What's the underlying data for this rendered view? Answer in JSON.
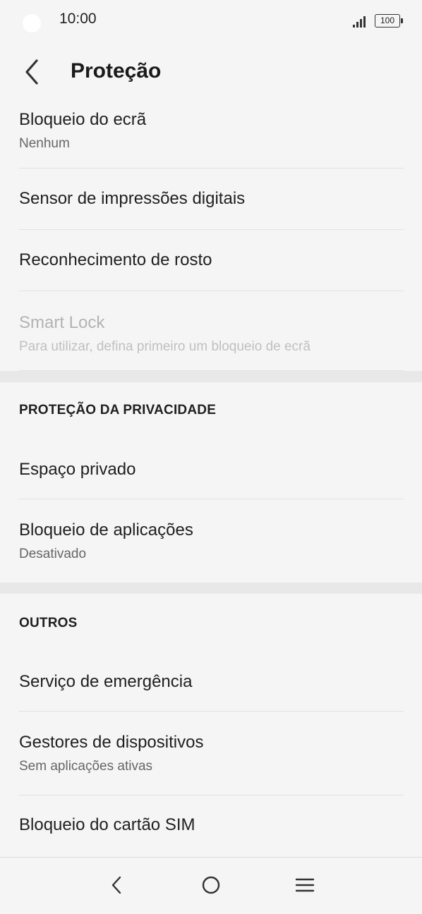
{
  "status_bar": {
    "time": "10:00",
    "battery": "100"
  },
  "header": {
    "title": "Proteção"
  },
  "items": {
    "screen_lock": {
      "title": "Bloqueio do ecrã",
      "subtitle": "Nenhum"
    },
    "fingerprint": {
      "title": "Sensor de impressões digitais"
    },
    "face": {
      "title": "Reconhecimento de rosto"
    },
    "smart_lock": {
      "title": "Smart Lock",
      "subtitle": "Para utilizar, defina primeiro um bloqueio de ecrã"
    },
    "private_space": {
      "title": "Espaço privado"
    },
    "app_lock": {
      "title": "Bloqueio de aplicações",
      "subtitle": "Desativado"
    },
    "emergency": {
      "title": "Serviço de emergência"
    },
    "device_admins": {
      "title": "Gestores de dispositivos",
      "subtitle": "Sem aplicações ativas"
    },
    "sim_lock": {
      "title": "Bloqueio do cartão SIM"
    }
  },
  "sections": {
    "privacy": "PROTEÇÃO DA PRIVACIDADE",
    "others": "OUTROS"
  },
  "icons": {
    "back": "chevron-left-icon",
    "nav_back": "nav-back-icon",
    "nav_home": "nav-home-icon",
    "nav_menu": "nav-menu-icon"
  }
}
